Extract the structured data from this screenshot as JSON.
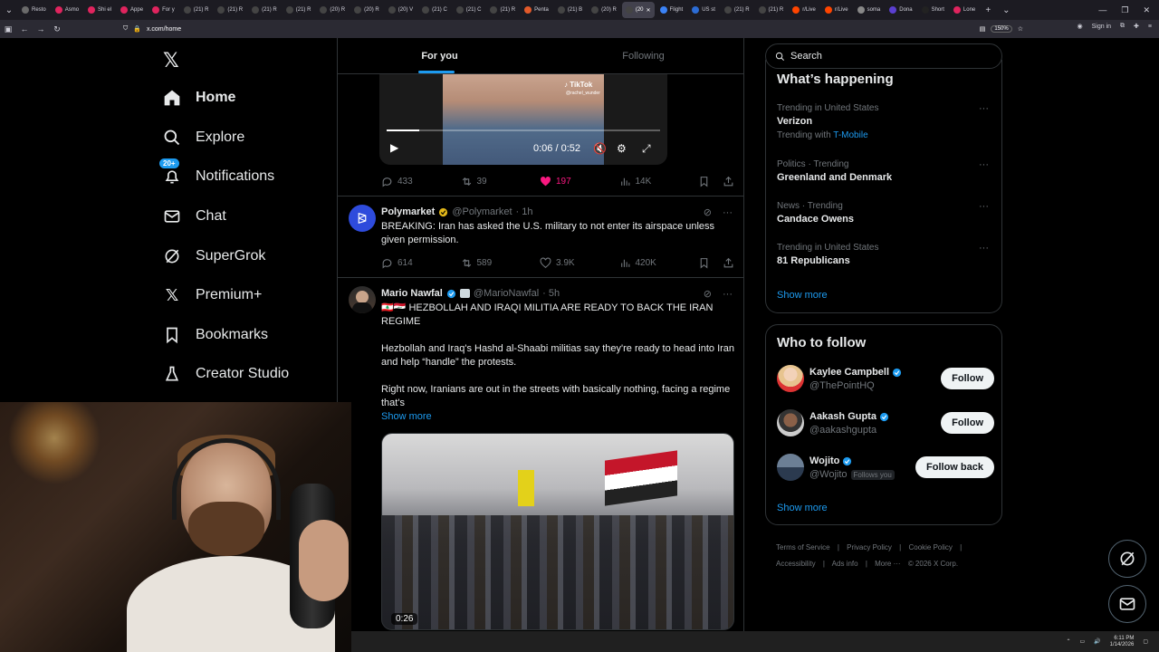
{
  "browser": {
    "tabs": [
      {
        "label": "Resto",
        "color": "#6a6a6a"
      },
      {
        "label": "Asmo",
        "color": "#e0245e"
      },
      {
        "label": "Shi el",
        "color": "#e0245e"
      },
      {
        "label": "Appe",
        "color": "#e0245e"
      },
      {
        "label": "For y",
        "color": "#e0245e"
      },
      {
        "label": "(21) R",
        "color": "#444"
      },
      {
        "label": "(21) R",
        "color": "#444"
      },
      {
        "label": "(21) R",
        "color": "#444"
      },
      {
        "label": "(21) R",
        "color": "#444"
      },
      {
        "label": "(20) R",
        "color": "#444"
      },
      {
        "label": "(20) R",
        "color": "#444"
      },
      {
        "label": "(20) V",
        "color": "#444"
      },
      {
        "label": "(21) C",
        "color": "#444"
      },
      {
        "label": "(21) C",
        "color": "#444"
      },
      {
        "label": "(21) R",
        "color": "#444"
      },
      {
        "label": "Penta",
        "color": "#e35a2a"
      },
      {
        "label": "(21) B",
        "color": "#444"
      },
      {
        "label": "(20) R",
        "color": "#444"
      },
      {
        "label": "(20",
        "color": "#444",
        "active": true
      },
      {
        "label": "Flight",
        "color": "#3b82f6"
      },
      {
        "label": "US st",
        "color": "#2c6cd4"
      },
      {
        "label": "(21) R",
        "color": "#444"
      },
      {
        "label": "(21) R",
        "color": "#444"
      },
      {
        "label": "r/Live",
        "color": "#ff4500"
      },
      {
        "label": "r/Live",
        "color": "#ff4500"
      },
      {
        "label": "soma",
        "color": "#888"
      },
      {
        "label": "Dona",
        "color": "#5b3fd1"
      },
      {
        "label": "Short",
        "color": "#222"
      },
      {
        "label": "Lone",
        "color": "#e0245e"
      }
    ],
    "url": "x.com/home",
    "zoom": "150%",
    "sign_in": "Sign in"
  },
  "nav": {
    "logo": "𝕏",
    "notifications_badge": "20+",
    "items": [
      {
        "label": "Home",
        "icon": "home-icon"
      },
      {
        "label": "Explore",
        "icon": "search-icon"
      },
      {
        "label": "Notifications",
        "icon": "bell-icon"
      },
      {
        "label": "Chat",
        "icon": "envelope-icon"
      },
      {
        "label": "SuperGrok",
        "icon": "grok-icon"
      },
      {
        "label": "Premium+",
        "icon": "x-icon"
      },
      {
        "label": "Bookmarks",
        "icon": "bookmark-icon"
      },
      {
        "label": "Creator Studio",
        "icon": "flask-icon"
      }
    ]
  },
  "timeline": {
    "tabs": [
      "For you",
      "Following"
    ],
    "post0": {
      "tiktok_label": "TikTok",
      "tiktok_handle": "@rachel_wunder",
      "video_time": "0:06 / 0:52",
      "replies": "433",
      "reposts": "39",
      "likes": "197",
      "views": "14K"
    },
    "post1": {
      "name": "Polymarket",
      "handle": "@Polymarket",
      "time": "· 1h",
      "text": "BREAKING: Iran has asked the U.S. military to not enter its airspace unless given permission.",
      "replies": "614",
      "reposts": "589",
      "likes": "3.9K",
      "views": "420K"
    },
    "post2": {
      "name": "Mario Nawfal",
      "handle": "@MarioNawfal",
      "time": "· 5h",
      "line1": "🇱🇧🇮🇶 HEZBOLLAH AND IRAQI MILITIA ARE READY TO BACK THE IRAN REGIME",
      "line2": "Hezbollah and Iraq's Hashd al-Shaabi militias say they're ready to head into Iran and help “handle” the protests.",
      "line3": "Right now, Iranians are out in the streets with basically nothing, facing a regime that's",
      "show_more": "Show more",
      "video_duration": "0:26"
    }
  },
  "sidebar": {
    "search_placeholder": "Search",
    "happening_title": "What’s happening",
    "trends": [
      {
        "meta": "Trending in United States",
        "topic": "Verizon",
        "with_label": "Trending with",
        "with_value": "T-Mobile"
      },
      {
        "meta": "Politics · Trending",
        "topic": "Greenland and Denmark"
      },
      {
        "meta": "News · Trending",
        "topic": "Candace Owens"
      },
      {
        "meta": "Trending in United States",
        "topic": "81 Republicans"
      }
    ],
    "trends_show_more": "Show more",
    "wtf_title": "Who to follow",
    "wtf": [
      {
        "name": "Kaylee Campbell",
        "handle": "@ThePointHQ",
        "button": "Follow"
      },
      {
        "name": "Aakash Gupta",
        "handle": "@aakashgupta",
        "button": "Follow"
      },
      {
        "name": "Wojito",
        "handle": "@Wojito",
        "follows_you": "Follows you",
        "button": "Follow back"
      }
    ],
    "wtf_show_more": "Show more",
    "footer": [
      "Terms of Service",
      "|",
      "Privacy Policy",
      "|",
      "Cookie Policy",
      "|",
      "Accessibility",
      "|",
      "Ads info",
      "|",
      "More ···",
      "© 2026 X Corp."
    ]
  },
  "taskbar": {
    "time": "6:11 PM",
    "date": "1/14/2026"
  },
  "colors": {
    "accent": "#1d9bf0",
    "like": "#f91880",
    "background": "#000000",
    "border": "#2f3336"
  }
}
